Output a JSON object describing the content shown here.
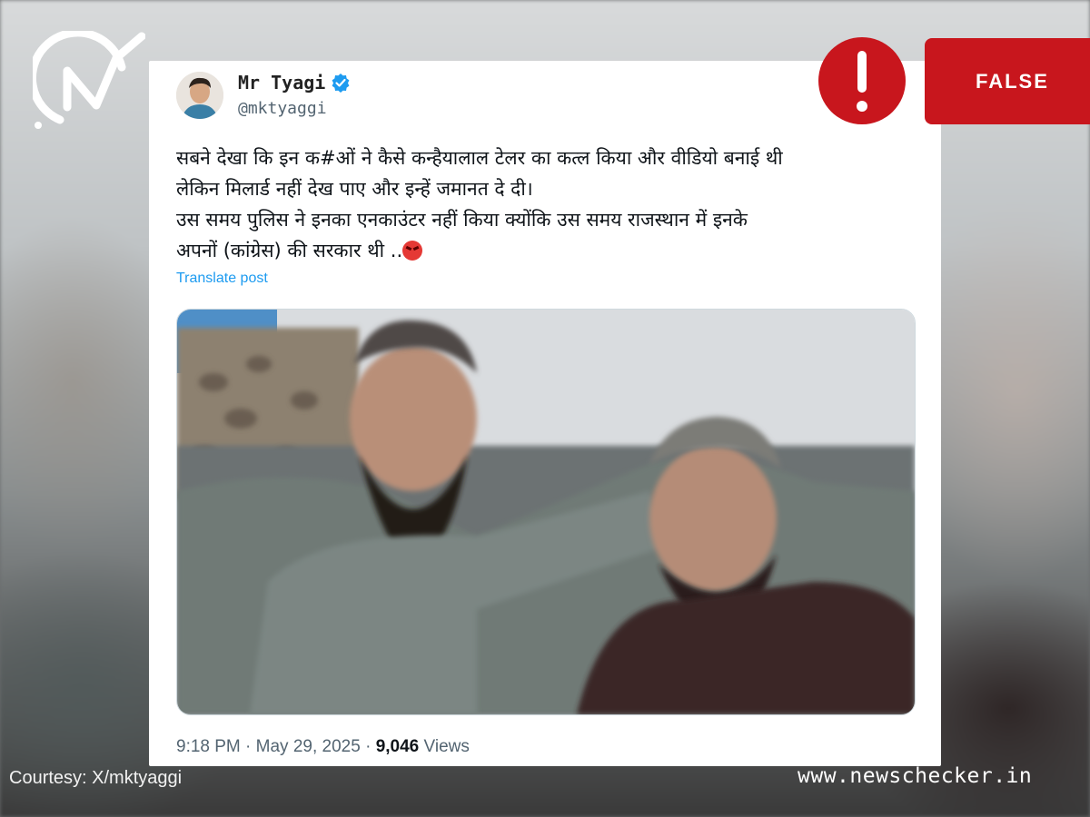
{
  "tweet": {
    "display_name": "Mr Tyagi",
    "handle": "@mktyaggi",
    "text_lines": [
      "सबने देखा कि इन क#ओं ने कैसे कन्हैयालाल टेलर का कत्ल किया और वीडियो बनाई थी",
      "लेकिन मिलार्ड नहीं देख पाए और इन्हें जमानत दे दी।",
      "उस समय पुलिस ने इनका एनकाउंटर नहीं किया क्योंकि उस समय राजस्थान में इनके",
      "अपनों (कांग्रेस) की सरकार थी .."
    ],
    "translate_label": "Translate post",
    "time": "9:18 PM",
    "date": "May 29, 2025",
    "views_count": "9,046",
    "views_label": "Views",
    "separator": "·"
  },
  "badge": {
    "label": "FALSE",
    "icon": "exclamation-icon"
  },
  "footer": {
    "courtesy": "Courtesy: X/mktyaggi",
    "site": "www.newschecker.in"
  },
  "colors": {
    "badge_red": "#c8161d",
    "link_blue": "#1d9bf0",
    "verified_blue": "#1d9bf0",
    "meta_gray": "#536471"
  }
}
